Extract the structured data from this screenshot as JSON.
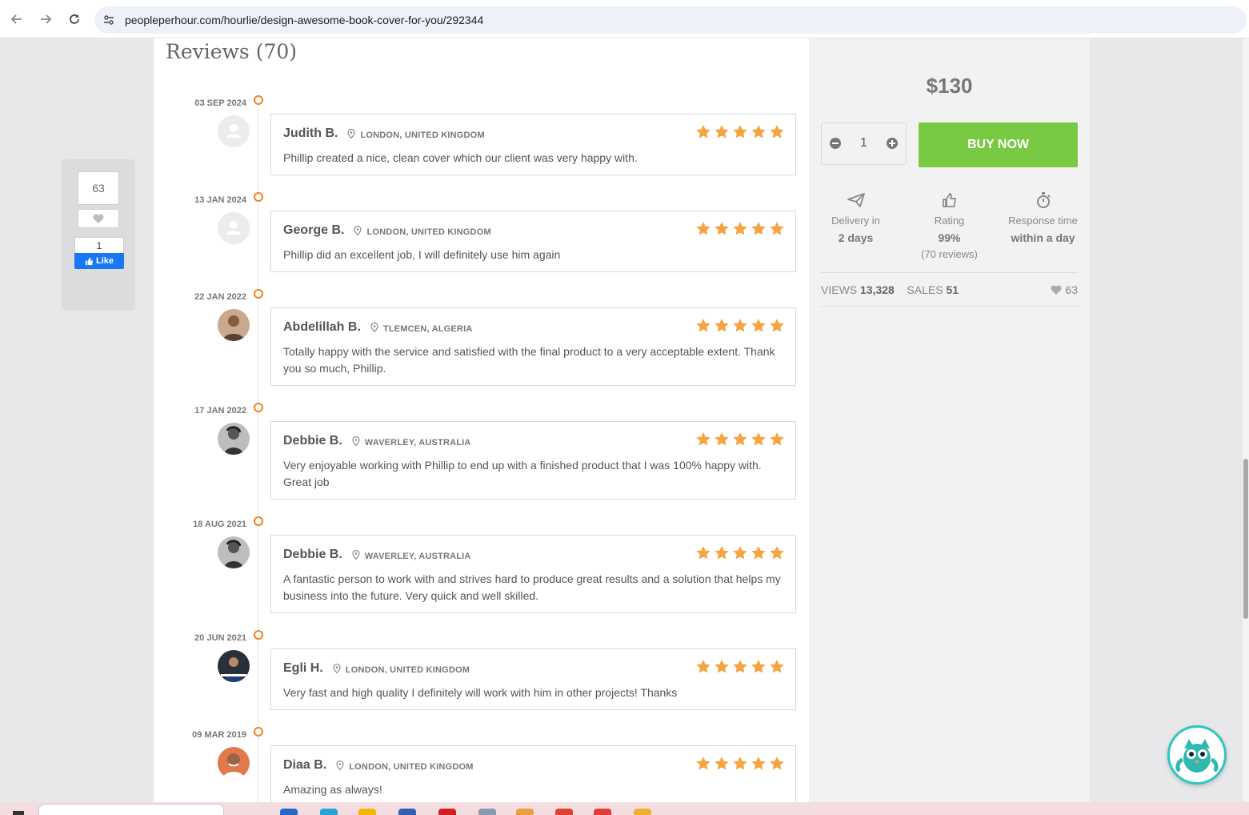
{
  "browser": {
    "url": "peopleperhour.com/hourlie/design-awesome-book-cover-for-you/292344"
  },
  "social": {
    "favorite_count": "63",
    "fb_like_count": "1",
    "fb_like_label": "Like"
  },
  "reviews": {
    "title": "Reviews (70)",
    "items": [
      {
        "date": "03 SEP 2024",
        "name": "Judith B.",
        "location": "LONDON, UNITED KINGDOM",
        "rating": 5,
        "text": "Phillip created a nice, clean cover which our client was very happy with.",
        "avatar": "placeholder"
      },
      {
        "date": "13 JAN 2024",
        "name": "George B.",
        "location": "LONDON, UNITED KINGDOM",
        "rating": 5,
        "text": "Phillip did an excellent job, I will definitely use him again",
        "avatar": "placeholder"
      },
      {
        "date": "22 JAN 2022",
        "name": "Abdelillah B.",
        "location": "TLEMCEN, ALGERIA",
        "rating": 5,
        "text": "Totally happy with the service and satisfied with the final product to a very acceptable extent. Thank you so much, Phillip.",
        "avatar": "photo"
      },
      {
        "date": "17 JAN 2022",
        "name": "Debbie B.",
        "location": "WAVERLEY, AUSTRALIA",
        "rating": 5,
        "text": "Very enjoyable working with Phillip to end up with a finished product that I was 100% happy with. Great job",
        "avatar": "photo"
      },
      {
        "date": "18 AUG 2021",
        "name": "Debbie B.",
        "location": "WAVERLEY, AUSTRALIA",
        "rating": 5,
        "text": "A fantastic person to work with and strives hard to produce great results and a solution that helps my business into the future. Very quick and well skilled.",
        "avatar": "photo"
      },
      {
        "date": "20 JUN 2021",
        "name": "Egli H.",
        "location": "LONDON, UNITED KINGDOM",
        "rating": 5,
        "text": "Very fast and high quality I definitely will work with him in other projects! Thanks",
        "avatar": "photo"
      },
      {
        "date": "09 MAR 2019",
        "name": "Diaa B.",
        "location": "LONDON, UNITED KINGDOM",
        "rating": 5,
        "text": "Amazing as always!",
        "avatar": "photo"
      }
    ]
  },
  "sidebar": {
    "price": "$130",
    "quantity": "1",
    "buy_label": "BUY NOW",
    "stats": {
      "delivery_label": "Delivery in",
      "delivery_value": "2 days",
      "rating_label": "Rating",
      "rating_value": "99%",
      "rating_sub": "(70 reviews)",
      "response_label": "Response time",
      "response_value": "within a day"
    },
    "views_label": "VIEWS",
    "views_value": "13,328",
    "sales_label": "SALES",
    "sales_value": "51",
    "likes_value": "63"
  },
  "colors": {
    "accent_orange": "#f5821f",
    "star": "#f5a442",
    "buy_green": "#7ac943",
    "fb_blue": "#1877f2"
  },
  "icons": [
    "back-icon",
    "forward-icon",
    "reload-icon",
    "site-info-icon",
    "heart-icon",
    "thumbs-up-icon",
    "pin-icon",
    "star-icon",
    "minus-icon",
    "plus-icon",
    "paper-plane-icon",
    "stopwatch-icon",
    "chat-bot-icon"
  ]
}
